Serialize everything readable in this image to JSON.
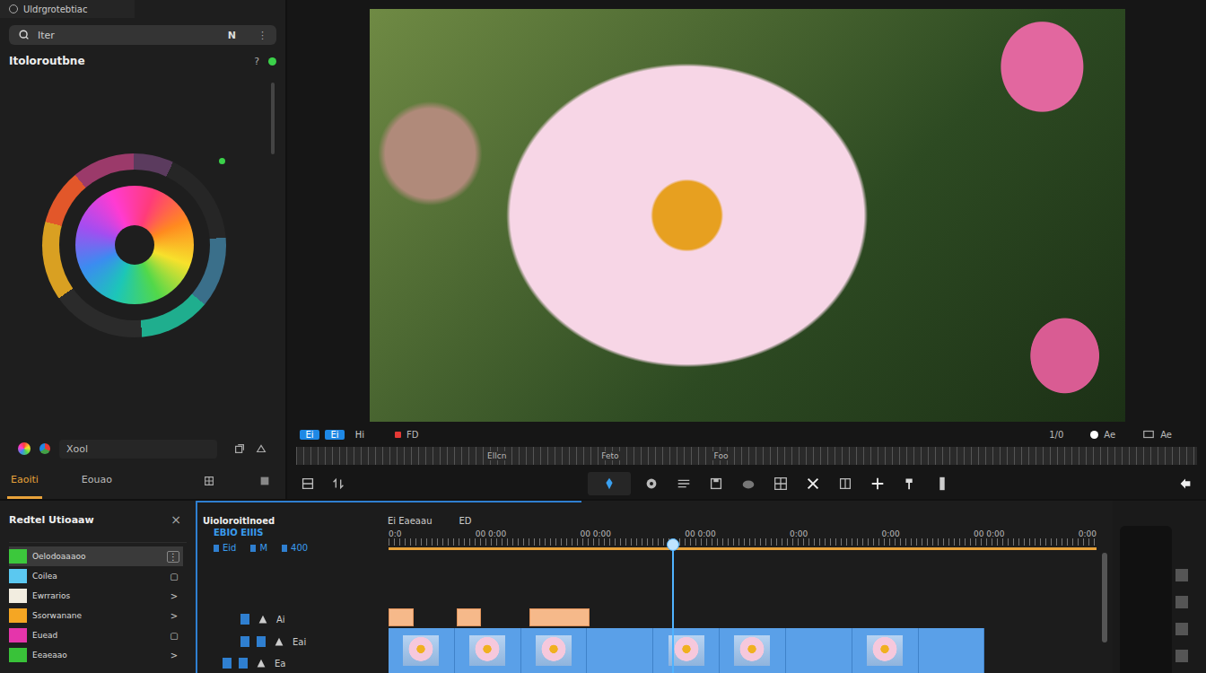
{
  "app": {
    "title": "Uldrgrotebtiac"
  },
  "search": {
    "value": "Iter",
    "shortcut": "N",
    "more": "⋮"
  },
  "color_panel": {
    "title": "Itoloroutbne",
    "help": "?"
  },
  "swatch_field": {
    "value": "Xool"
  },
  "left_tabs": [
    {
      "label": "Eaoiti",
      "selected": true
    },
    {
      "label": "Eouao",
      "selected": false
    }
  ],
  "preview": {
    "buttons": [
      {
        "label": "Ei",
        "selected": true
      },
      {
        "label": "Ei",
        "selected": true
      },
      {
        "label": "Hi",
        "selected": false
      }
    ],
    "record": "FD",
    "right_labels": [
      "1/0",
      "Ae",
      "Ae"
    ],
    "ruler": [
      "Ellcn",
      "Feto",
      "Foo"
    ],
    "tools_left": [
      {
        "kind": "layout",
        "selected": false
      },
      {
        "kind": "sort",
        "selected": false
      }
    ],
    "tools": [
      {
        "kind": "pin",
        "selected": true
      },
      {
        "kind": "gear",
        "selected": false
      },
      {
        "kind": "lines",
        "selected": false
      },
      {
        "kind": "save",
        "selected": false
      },
      {
        "kind": "cloud",
        "selected": false
      },
      {
        "kind": "grid",
        "selected": false
      },
      {
        "kind": "cross",
        "selected": false
      },
      {
        "kind": "split",
        "selected": false
      },
      {
        "kind": "plus",
        "selected": false
      },
      {
        "kind": "pen",
        "selected": false
      },
      {
        "kind": "column",
        "selected": false
      }
    ],
    "tools_right": [
      {
        "kind": "back",
        "selected": false
      }
    ]
  },
  "media_panel": {
    "title": "Redtel Utioaaw",
    "close": "×",
    "items": [
      {
        "label": "Oelodoaaaoo",
        "color": "#3cc83c",
        "marker": "⋮",
        "selected": true
      },
      {
        "label": "Coilea",
        "color": "#5bc8f0",
        "marker": "▢",
        "selected": false
      },
      {
        "label": "Ewrrarios",
        "color": "#f2ede0",
        "marker": ">",
        "selected": false
      },
      {
        "label": "Ssorwanane",
        "color": "#f5a623",
        "marker": ">",
        "selected": false
      },
      {
        "label": "Euead",
        "color": "#e535ab",
        "marker": "▢",
        "selected": false
      },
      {
        "label": "Eeaeaao",
        "color": "#39c239",
        "marker": ">",
        "selected": false
      }
    ]
  },
  "timeline": {
    "title": "Uioloroitlnoed",
    "subtitle": "EBIO EIIIS",
    "meta": [
      "Eid",
      "M",
      "400"
    ],
    "header_items": [
      "Ei Eaeaau",
      "ED"
    ],
    "ruler": [
      "0:0",
      "00 0:00",
      "00 0:00",
      "00 0:00",
      "0:00",
      "0:00",
      "00 0:00",
      "0:00"
    ],
    "playhead": {
      "level": 0.4
    },
    "tracks": [
      {
        "label": "Ai",
        "kind": "clips",
        "clips": [
          {
            "from": 0.0,
            "to": 0.035
          },
          {
            "from": 0.096,
            "to": 0.131
          },
          {
            "from": 0.199,
            "to": 0.284
          }
        ]
      },
      {
        "label": "Eai",
        "kind": "video",
        "span": {
          "from": 0.0,
          "to": 0.842
        },
        "frames": [
          {
            "thumbnail": true
          },
          {
            "thumbnail": true
          },
          {
            "thumbnail": true
          },
          {
            "thumbnail": false
          },
          {
            "thumbnail": true
          },
          {
            "thumbnail": true
          },
          {
            "thumbnail": false
          },
          {
            "thumbnail": true
          },
          {
            "thumbnail": false
          }
        ]
      },
      {
        "label": "Ea",
        "kind": "empty"
      }
    ]
  }
}
